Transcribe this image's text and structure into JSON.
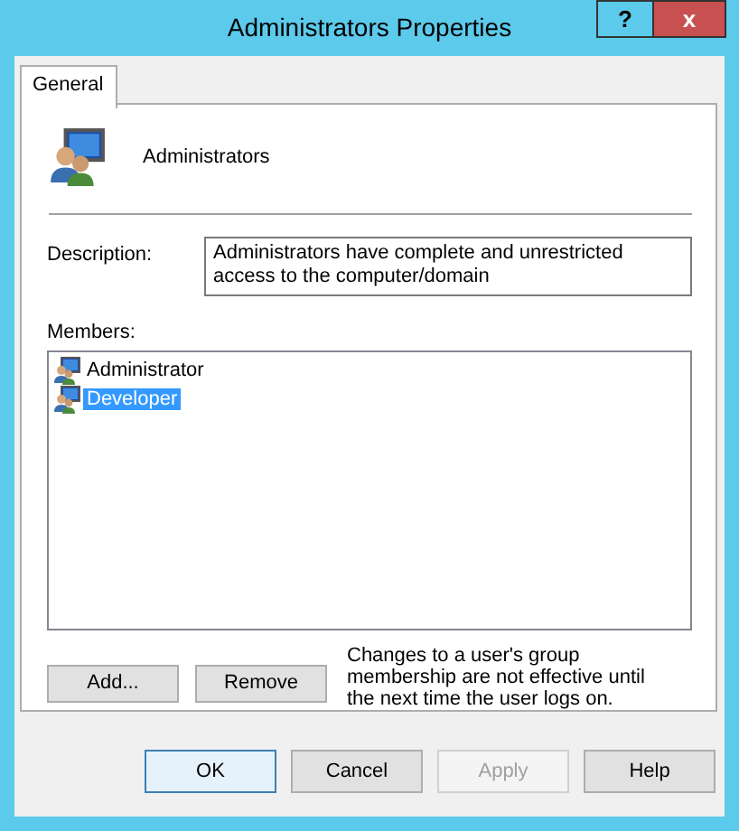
{
  "window": {
    "title": "Administrators Properties",
    "help_button": "?",
    "close_button": "x"
  },
  "tabs": [
    {
      "label": "General",
      "selected": true
    }
  ],
  "group": {
    "name": "Administrators"
  },
  "description": {
    "label": "Description:",
    "value": "Administrators have complete and unrestricted access to the computer/domain"
  },
  "members": {
    "label": "Members:",
    "items": [
      {
        "name": "Administrator",
        "selected": false
      },
      {
        "name": "Developer",
        "selected": true
      }
    ]
  },
  "member_buttons": [
    {
      "label": "Add...",
      "disabled": false
    },
    {
      "label": "Remove",
      "disabled": false
    }
  ],
  "note": "Changes to a user's group membership are not effective until the next time the user logs on.",
  "dialog_buttons": [
    {
      "label": "OK",
      "disabled": false,
      "default": true
    },
    {
      "label": "Cancel",
      "disabled": false,
      "default": false
    },
    {
      "label": "Apply",
      "disabled": true,
      "default": false
    },
    {
      "label": "Help",
      "disabled": false,
      "default": false
    }
  ]
}
